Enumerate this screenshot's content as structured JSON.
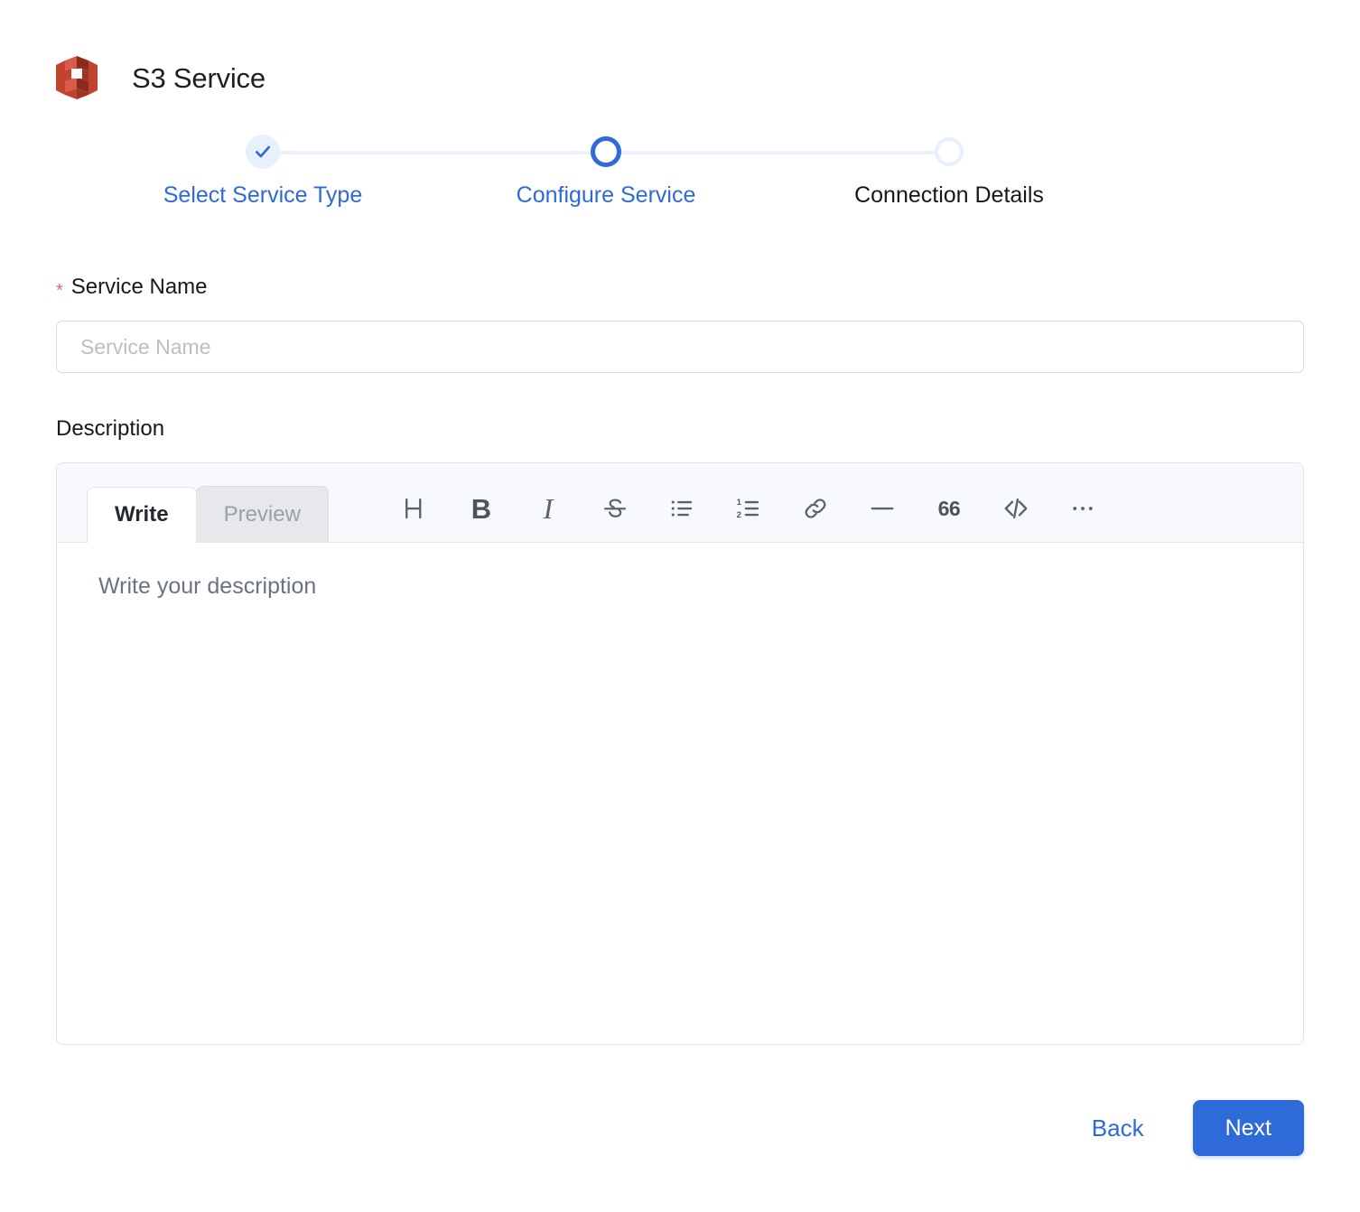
{
  "header": {
    "title": "S3 Service",
    "icon": "aws-s3-icon",
    "icon_colors": {
      "light": "#d95b4a",
      "mid": "#c0432f",
      "dark": "#8c2b1d"
    }
  },
  "stepper": {
    "steps": [
      {
        "label": "Select Service Type",
        "state": "completed",
        "icon": "check-icon"
      },
      {
        "label": "Configure Service",
        "state": "active",
        "icon": "circle-icon"
      },
      {
        "label": "Connection Details",
        "state": "upcoming",
        "icon": "circle-icon"
      }
    ],
    "colors": {
      "accent": "#2f6ad9",
      "track": "#eaf1fd",
      "completed_fill": "#e7f0fd",
      "upcoming_ring": "#e7f0fd"
    }
  },
  "form": {
    "service_name": {
      "label": "Service Name",
      "required_marker": "*",
      "value": "",
      "placeholder": "Service Name"
    },
    "description": {
      "label": "Description",
      "tabs": [
        {
          "label": "Write",
          "active": true
        },
        {
          "label": "Preview",
          "active": false
        }
      ],
      "toolbar": [
        {
          "name": "heading-icon",
          "glyph": "H"
        },
        {
          "name": "bold-icon",
          "glyph": "B"
        },
        {
          "name": "italic-icon",
          "glyph": "I"
        },
        {
          "name": "strikethrough-icon",
          "glyph": "S"
        },
        {
          "name": "bullet-list-icon",
          "glyph": ""
        },
        {
          "name": "numbered-list-icon",
          "glyph": ""
        },
        {
          "name": "link-icon",
          "glyph": ""
        },
        {
          "name": "horizontal-rule-icon",
          "glyph": ""
        },
        {
          "name": "blockquote-icon",
          "glyph": "66"
        },
        {
          "name": "code-icon",
          "glyph": "</>"
        },
        {
          "name": "more-options-icon",
          "glyph": ""
        }
      ],
      "body_value": "",
      "body_placeholder": "Write your description"
    }
  },
  "footer": {
    "back_label": "Back",
    "next_label": "Next",
    "next_color": "#2f6ad9"
  }
}
